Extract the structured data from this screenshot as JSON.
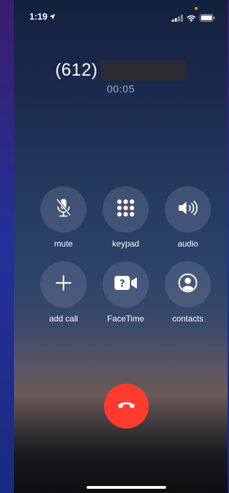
{
  "status_bar": {
    "time": "1:19",
    "location_icon": "location-arrow-icon",
    "signal_icon": "cellular-signal-icon",
    "wifi_icon": "wifi-icon",
    "battery_icon": "battery-icon"
  },
  "call": {
    "number_prefix": "(612)",
    "duration": "00:05"
  },
  "controls": {
    "mute": {
      "label": "mute",
      "icon": "microphone-slash-icon"
    },
    "keypad": {
      "label": "keypad",
      "icon": "keypad-grid-icon"
    },
    "audio": {
      "label": "audio",
      "icon": "speaker-icon"
    },
    "add_call": {
      "label": "add call",
      "icon": "plus-icon"
    },
    "facetime": {
      "label": "FaceTime",
      "icon": "facetime-video-icon"
    },
    "contacts": {
      "label": "contacts",
      "icon": "person-circle-icon"
    }
  },
  "end_call": {
    "icon": "phone-hangup-icon"
  },
  "colors": {
    "end_call_red": "#ff3b30",
    "button_fill": "rgba(120,130,160,0.33)",
    "duration_gray": "#9fa6b5",
    "mic_indicator_orange": "#ff9f0a"
  }
}
